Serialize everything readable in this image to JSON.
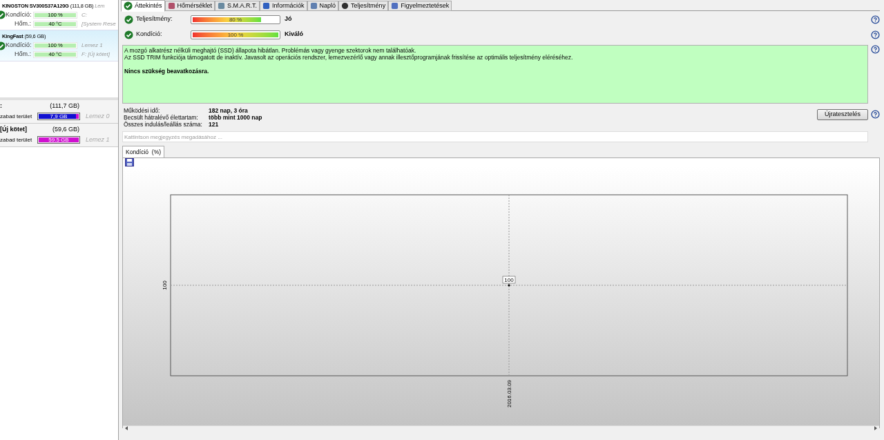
{
  "disks": [
    {
      "title": "KINGSTON SV300S37A120G",
      "size": "(111,8 GB)",
      "extra": "Lem",
      "selected": false,
      "rows": [
        {
          "label": "Kondíció:",
          "value": "100 %",
          "level": 1,
          "note": "C:"
        },
        {
          "label": "Hőm.:",
          "value": "40 °C",
          "level": 1,
          "note": "[System Rese"
        }
      ]
    },
    {
      "title": "KingFast",
      "size": "(59,6 GB)",
      "selected": true,
      "rows": [
        {
          "label": "Kondíció:",
          "value": "100 %",
          "level": 1,
          "note": "Lemez 1"
        },
        {
          "label": "Hőm.:",
          "value": "40 °C",
          "level": 1,
          "note": "F: [Új kötet]"
        }
      ]
    }
  ],
  "partitions": [
    {
      "name": ":",
      "size": "(111,7 GB)",
      "label": "zabad terület",
      "value": "7,9 GB",
      "level": 0.93,
      "color": "#1010d0",
      "disk": "Lemez 0"
    },
    {
      "name": "[Új kötet]",
      "size": "(59,6 GB)",
      "label": "zabad terület",
      "value": "59.5 GB",
      "level": 0.99,
      "color": "#d010d0",
      "disk": "Lemez 1"
    }
  ],
  "tabs": [
    {
      "label": "Áttekintés",
      "selected": true
    },
    {
      "label": "Hőmérséklet",
      "selected": false
    },
    {
      "label": "S.M.A.R.T.",
      "selected": false
    },
    {
      "label": "Információk",
      "selected": false
    },
    {
      "label": "Napló",
      "selected": false
    },
    {
      "label": "Teljesítmény",
      "selected": false
    },
    {
      "label": "Figyelmeztetések",
      "selected": false
    }
  ],
  "meters": [
    {
      "label": "Teljesítmény:",
      "value": "80 %",
      "level": 0.8,
      "rating": "Jó"
    },
    {
      "label": "Kondíció:",
      "value": "100 %",
      "level": 1,
      "rating": "Kiváló"
    }
  ],
  "message": {
    "lines": [
      "A mozgó alkatrész nélküli meghajtó (SSD) állapota hibátlan. Problémás vagy gyenge szektorok nem találhatóak.",
      "Az SSD TRIM funkciója támogatott de inaktív. Javasolt az operációs rendszer, lemezvezérlő vagy annak illesztőprogramjának frissítése az optimális teljesítmény eléréséhez."
    ],
    "conclusion": "Nincs szükség beavatkozásra."
  },
  "info": [
    {
      "label": "Működési idő:",
      "value": "182 nap, 3 óra"
    },
    {
      "label": "Becsült hátralévő élettartam:",
      "value": "több mint 1000 nap"
    },
    {
      "label": "Összes indulás/leállás száma:",
      "value": "121"
    }
  ],
  "retest_button": "Újratesztelés",
  "note_field": {
    "placeholder": "Kattintson megjegyzés megadásához ..."
  },
  "chart": {
    "tab": "Kondíció  (%)",
    "y_axis_label": "100",
    "x_axis_label": "2016.03.09",
    "point_label": "100"
  }
}
